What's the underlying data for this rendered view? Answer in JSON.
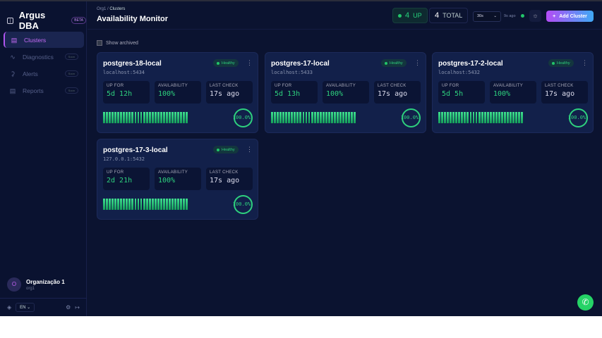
{
  "app": {
    "name": "Argus DBA",
    "beta": "BETA"
  },
  "nav": [
    {
      "label": "Clusters",
      "icon": "database-icon",
      "active": true
    },
    {
      "label": "Diagnostics",
      "soon": "Soon"
    },
    {
      "label": "Alerts",
      "soon": "Soon"
    },
    {
      "label": "Reports",
      "soon": "Soon"
    }
  ],
  "org": {
    "initial": "O",
    "name": "Organização 1",
    "slug": "org1"
  },
  "footer": {
    "lang": "EN"
  },
  "header": {
    "crumb_org": "Org1",
    "crumb_sep": "/",
    "crumb_page": "Clusters",
    "title": "Availability Monitor",
    "up_count": "4",
    "up_label": "UP",
    "total_count": "4",
    "total_label": "TOTAL",
    "interval": "30s",
    "refreshed": "9s ago",
    "add_label": "Add Cluster"
  },
  "filters": {
    "show_archived": "Show archived"
  },
  "labels": {
    "up_for": "UP FOR",
    "availability": "AVAILABILITY",
    "last_check": "LAST CHECK"
  },
  "clusters": [
    {
      "name": "postgres-18-local",
      "host": "localhost:5434",
      "status": "Healthy",
      "up_for": "5d 12h",
      "availability": "100%",
      "last_check": "17s ago",
      "uptime_pct": "100.0%"
    },
    {
      "name": "postgres-17-local",
      "host": "localhost:5433",
      "status": "Healthy",
      "up_for": "5d 13h",
      "availability": "100%",
      "last_check": "17s ago",
      "uptime_pct": "100.0%"
    },
    {
      "name": "postgres-17-2-local",
      "host": "localhost:5432",
      "status": "Healthy",
      "up_for": "5d 5h",
      "availability": "100%",
      "last_check": "17s ago",
      "uptime_pct": "100.0%"
    },
    {
      "name": "postgres-17-3-local",
      "host": "127.0.0.1:5432",
      "status": "Healthy",
      "up_for": "2d 21h",
      "availability": "100%",
      "last_check": "17s ago",
      "uptime_pct": "100.0%"
    }
  ],
  "colors": {
    "accent": "#b055f0",
    "healthy": "#2ed17e"
  }
}
